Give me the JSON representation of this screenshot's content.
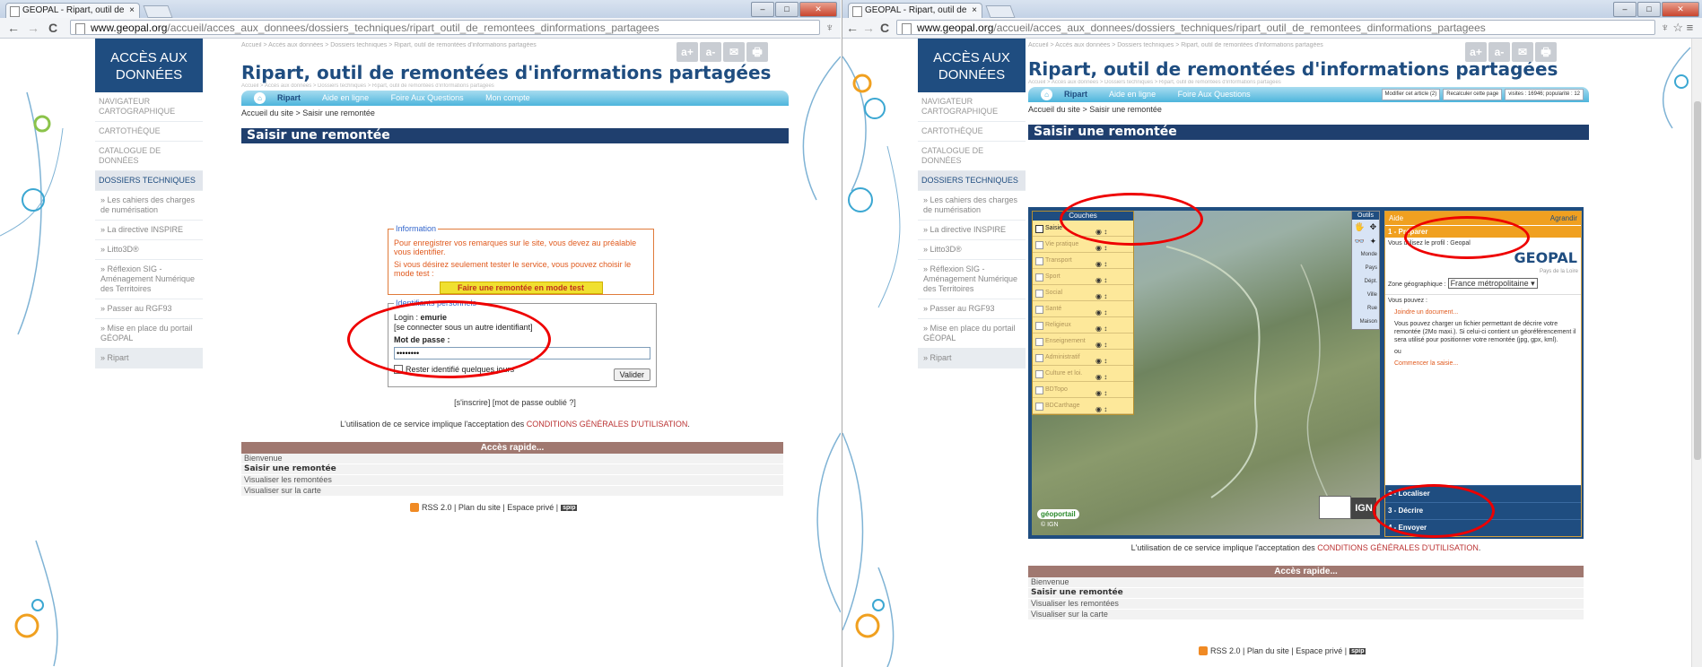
{
  "browser": {
    "tab_title": "GEOPAL - Ripart, outil de",
    "tab_close": "×",
    "url_host": "www.geopal.org",
    "url_path": "/accueil/acces_aux_donnees/dossiers_techniques/ripart_outil_de_remontees_dinformations_partagees",
    "nav_back": "←",
    "nav_forward": "→",
    "nav_reload": "C",
    "left_extra_icon": "♆",
    "right_extra_icons": "♆ ☆ ≡",
    "win_min": "–",
    "win_max": "□",
    "win_close": "✕"
  },
  "sidebar": {
    "header": "ACCÈS AUX DONNÉES",
    "items": [
      "NAVIGATEUR CARTOGRAPHIQUE",
      "CARTOTHÈQUE",
      "CATALOGUE DE DONNÉES",
      "DOSSIERS TECHNIQUES",
      "» Les cahiers des charges de numérisation",
      "» La directive INSPIRE",
      "» Litto3D®",
      "» Réflexion SIG - Aménagement Numérique des Territoires",
      "» Passer au RGF93",
      "» Mise en place du portail GÉOPAL",
      "» Ripart"
    ]
  },
  "header": {
    "crumb_top": "Accueil > Accès aux données > Dossiers techniques > Ripart, outil de remontées d'informations partagées",
    "title": "Ripart, outil de remontées d'informations partagées",
    "crumb_small": "Accueil > Accès aux données > Dossiers techniques > Ripart, outil de remontées d'informations partagées",
    "tools": [
      "a+",
      "a-",
      "✉",
      "🖶"
    ]
  },
  "menu": {
    "home": "⌂",
    "items": [
      "Ripart",
      "Aide en ligne",
      "Foire Aux Questions",
      "Mon compte"
    ],
    "right_items": [
      "Ripart",
      "Aide en ligne",
      "Foire Aux Questions"
    ],
    "extras": [
      "Modifier cet article (2)",
      "Recalculer cette page",
      "visites : 16946; popularité : 12"
    ]
  },
  "crumb2": "Accueil du site > Saisir une remontée",
  "section_title": "Saisir une remontée",
  "info": {
    "legend": "Information",
    "p1": "Pour enregistrer vos remarques sur le site, vous devez au préalable vous identifier.",
    "p2": "Si vous désirez seulement tester le service, vous pouvez choisir le mode test :",
    "test_button": "Faire une remontée en mode test"
  },
  "ident": {
    "legend": "Identifiants personnels",
    "login_label": "Login : ",
    "login_value": "emurie",
    "other": "[se connecter sous un autre identifiant]",
    "password_label": "Mot de passe :",
    "password_value": "••••••••",
    "remember": "Rester identifié quelques jours",
    "submit": "Valider"
  },
  "links": "[s'inscrire] [mot de passe oublié ?]",
  "conditions": {
    "prefix": "L'utilisation de ce service implique l'acceptation des ",
    "link": "CONDITIONS GÉNÉRALES D'UTILISATION",
    "suffix": "."
  },
  "quick": {
    "title": "Accès rapide...",
    "items": [
      "Bienvenue",
      "Saisir une remontée",
      "Visualiser les remontées",
      "Visualiser sur la carte"
    ]
  },
  "footer": {
    "text": "RSS 2.0 | Plan du site | Espace privé |",
    "spip": "spip"
  },
  "map_app": {
    "layers_title": "Couches",
    "layers": [
      "Saisie",
      "Vie pratique",
      "Transport",
      "Sport",
      "Social",
      "Santé",
      "Religieux",
      "Enseignement",
      "Administratif",
      "Culture et loi.",
      "BDTopo",
      "BDCarthage"
    ],
    "layer_icons": "◉ ↕",
    "tools_title": "Outils",
    "tools_glyphs": [
      "🖐",
      "✥"
    ],
    "tools_binoc": [
      "👓",
      "✦"
    ],
    "tools": [
      "Monde",
      "Pays",
      "Dépt.",
      "Ville",
      "Rue",
      "Maison"
    ],
    "panel_title": "Aide",
    "panel_enlarge": "Agrandir",
    "step1": "1 - Préparer",
    "profile": "Vous utilisez le profil : Geopal",
    "logo": "GEOPAL",
    "pays": "Pays de la Loire",
    "zone_label": "Zone géographique : ",
    "zone_value": "France métropolitaine ▾",
    "vous_pouvez": "Vous pouvez :",
    "joindre": "Joindre un document...",
    "joindre_desc": "Vous pouvez charger un fichier permettant de décrire votre remontée (2Mo maxi.). Si celui-ci contient un géoréférencement il sera utilisé pour positionner votre remontée (jpg, gpx, kml).",
    "ou": "ou",
    "commencer": "Commencer la saisie...",
    "steps": [
      "2 - Localiser",
      "3 - Décrire",
      "4 - Envoyer"
    ],
    "gn": "IGN",
    "geoportail": "géoportail"
  },
  "colors": {
    "navy": "#1f4d80",
    "annotation_red": "#e00000",
    "orange": "#f0a020"
  }
}
